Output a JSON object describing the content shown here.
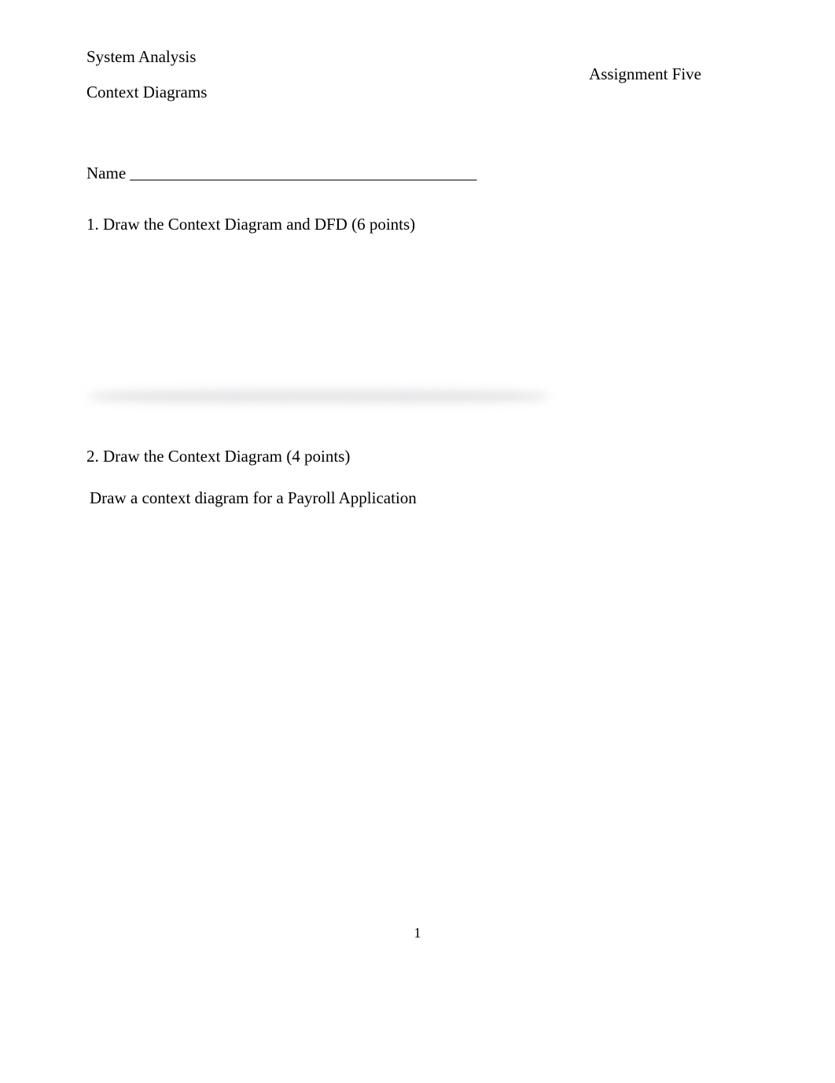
{
  "header": {
    "title": "System Analysis",
    "assignment": "Assignment Five",
    "subtitle": "Context Diagrams"
  },
  "nameField": {
    "label": "Name",
    "blank": " __________________________________________"
  },
  "questions": {
    "q1": "1. Draw the Context Diagram and DFD (6 points)",
    "q2": "2.  Draw the Context Diagram (4 points)",
    "q2body": "Draw a context diagram for a Payroll Application"
  },
  "pageNumber": "1"
}
